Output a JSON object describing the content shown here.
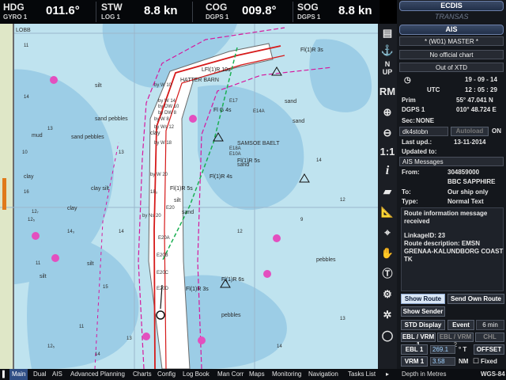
{
  "instruments": [
    {
      "label": "HDG",
      "source": "GYRO 1",
      "value": "011.6°"
    },
    {
      "label": "STW",
      "source": "LOG 1",
      "value": "8.8 kn"
    },
    {
      "label": "COG",
      "source": "DGPS 1",
      "value": "009.8°"
    },
    {
      "label": "SOG",
      "source": "DGPS 1",
      "value": "8.8 kn"
    }
  ],
  "chart": {
    "places": [
      "HATTER BARN",
      "SAMSOE BAELT",
      "LOBB"
    ],
    "seabed": [
      "mud",
      "sand pebbles",
      "sand pebbles",
      "clay",
      "clay silt",
      "clay",
      "silt",
      "silt",
      "silt",
      "sand",
      "sand",
      "pebbles",
      "pebbles",
      "sand",
      "clay",
      "sand",
      "silt"
    ],
    "lights": [
      "LFl(1)R 10s",
      "Fl(1)R 3s",
      "Fl G 4s",
      "Fl(1)R 5s",
      "Fl(1)R 4s",
      "Fl(1)R 6s",
      "Fl(1)R 3s",
      "Fl(1)R 5s"
    ],
    "depths": [
      "11",
      "14",
      "12₇",
      "13",
      "10",
      "16",
      "12₅",
      "11",
      "14₃",
      "13",
      "14",
      "18₃",
      "15",
      "13",
      "11",
      "14",
      "12",
      "9",
      "12",
      "13",
      "14",
      "12₅",
      "14"
    ],
    "route_labels": [
      "E10A",
      "E14A",
      "E18A",
      "E20B",
      "E20C",
      "E20D",
      "E20A",
      "E20",
      "E17",
      "by W 20",
      "by W 18",
      "by W 14",
      "by W 10",
      "by W 8",
      "by Ws 12",
      "by Ns 20",
      "by DW 10",
      "by DW 8"
    ],
    "colors": {
      "shallow": "#9ccde6",
      "deep": "#bfe3ef",
      "land": "#dfe7c7",
      "channel": "#ffffff",
      "route": "#d61a1a",
      "border": "#d6189e",
      "track": "#1bb052"
    }
  },
  "toolbar": {
    "north_up_top": "N",
    "north_up_bottom": "UP",
    "rm": "RM",
    "one_to_one": "1:1",
    "info": "i"
  },
  "panel": {
    "logo": "ECDIS",
    "brand": "TRANSAS",
    "mode": "AIS",
    "master": "* (W01) MASTER *",
    "chart_status": "No official chart",
    "xtd_status": "Out of XTD",
    "date": "19 - 09 - 14",
    "time": "12 : 05 : 29",
    "utc": "UTC",
    "prim_label": "Prim",
    "lat": "55° 47.041 N",
    "dgps_label": "DGPS 1",
    "lon": "010° 48.724 E",
    "sec_label": "Sec:",
    "sec_value": "NONE",
    "user": "dk4stobn",
    "autoload": "Autoload",
    "on": "ON",
    "last_upd_label": "Last upd.:",
    "last_upd_value": "13-11-2014",
    "updated_to_label": "Updated to:",
    "ais_messages": "AIS Messages",
    "from_label": "From:",
    "from_mmsi": "304859000",
    "from_name": "BBC SAPPHIRE",
    "to_label": "To:",
    "to_value": "Our ship only",
    "type_label": "Type:",
    "type_value": "Normal Text",
    "message": {
      "title": "Route information message received",
      "link": "LinkageID: 23",
      "desc1": "Route description: EMSN",
      "desc2": "GRENAA-KALUNDBORG COAST",
      "desc3": "TK"
    },
    "show_route": "Show Route",
    "send_own_route": "Send Own Route",
    "show_sender": "Show Sender",
    "std_display": "STD Display",
    "event": "Event",
    "interval": "6 min",
    "ebl_vrm_1": "EBL / VRM 1",
    "ebl_vrm_2": "EBL / VRM 2",
    "chl": "CHL",
    "ebl1": "EBL 1",
    "ebl1_value": "269.1",
    "ebl1_unit": "° T",
    "offset": "OFFSET",
    "vrm1": "VRM 1",
    "vrm1_value": "3.58",
    "vrm1_unit": "NM",
    "fixed": "Fixed",
    "depth_units": "Depth in Metres",
    "datum": "WGS-84"
  },
  "menu": [
    "Main",
    "Dual",
    "AIS",
    "Advanced Planning",
    "Charts",
    "Config",
    "Log Book",
    "Man Corr",
    "Maps",
    "Monitoring",
    "Navigation",
    "Tasks List"
  ]
}
